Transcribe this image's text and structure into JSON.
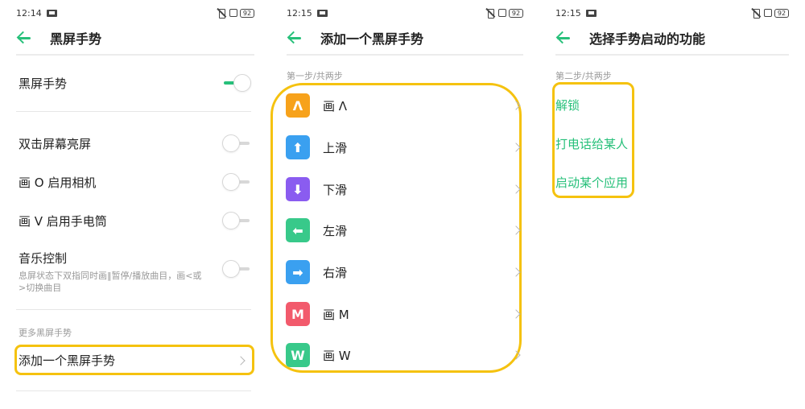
{
  "status": [
    {
      "time": "12:14",
      "battery": "92"
    },
    {
      "time": "12:15",
      "battery": "92"
    },
    {
      "time": "12:15",
      "battery": "92"
    }
  ],
  "screen1": {
    "title": "黑屏手势",
    "master_label": "黑屏手势",
    "master_on": true,
    "items": [
      {
        "label": "双击屏幕亮屏",
        "sub": "",
        "on": false
      },
      {
        "label": "画 O 启用相机",
        "sub": "",
        "on": false
      },
      {
        "label": "画 V 启用手电筒",
        "sub": "",
        "on": false
      },
      {
        "label": "音乐控制",
        "sub": "息屏状态下双指同时画‖暂停/播放曲目，画<或>切换曲目",
        "on": false
      }
    ],
    "section": "更多黑屏手势",
    "add_label": "添加一个黑屏手势"
  },
  "screen2": {
    "title": "添加一个黑屏手势",
    "step": "第一步/共两步",
    "gestures": [
      {
        "icon": "caret-up-icon",
        "glyph": "Λ",
        "color": "#f7a21b",
        "label": "画 Λ"
      },
      {
        "icon": "arrow-up-icon",
        "glyph": "⬆",
        "color": "#3aa0f0",
        "label": "上滑"
      },
      {
        "icon": "arrow-down-icon",
        "glyph": "⬇",
        "color": "#8a5cf0",
        "label": "下滑"
      },
      {
        "icon": "arrow-left-icon",
        "glyph": "⬅",
        "color": "#38c98a",
        "label": "左滑"
      },
      {
        "icon": "arrow-right-icon",
        "glyph": "➡",
        "color": "#3aa0f0",
        "label": "右滑"
      },
      {
        "icon": "letter-m-icon",
        "glyph": "M",
        "color": "#f25a6c",
        "label": "画 M"
      },
      {
        "icon": "letter-w-icon",
        "glyph": "W",
        "color": "#38c98a",
        "label": "画 W"
      }
    ]
  },
  "screen3": {
    "title": "选择手势启动的功能",
    "step": "第二步/共两步",
    "functions": [
      "解锁",
      "打电话给某人",
      "启动某个应用"
    ]
  },
  "colors": {
    "accent": "#27c07a",
    "highlight": "#f5c20f"
  }
}
